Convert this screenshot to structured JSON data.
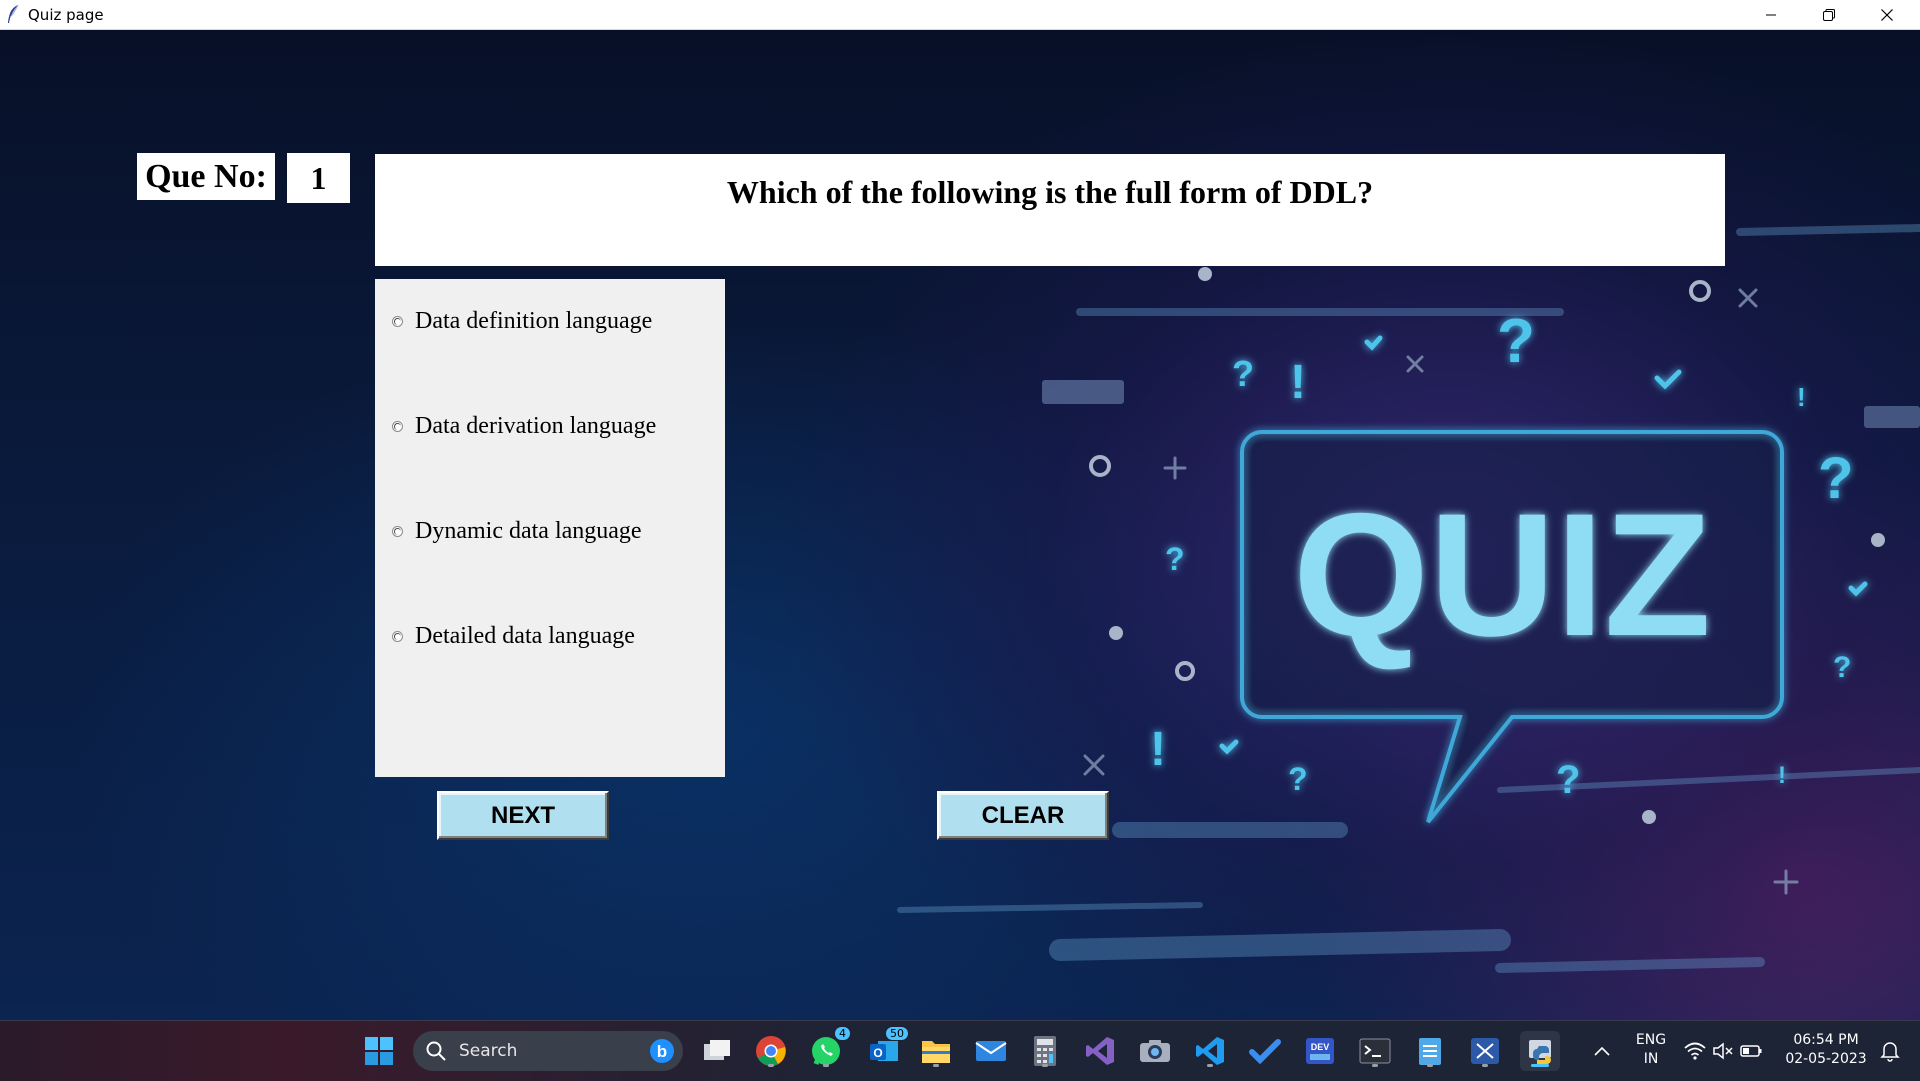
{
  "window": {
    "title": "Quiz page"
  },
  "quiz": {
    "que_no_label": "Que No:",
    "que_no_value": "1",
    "question": "Which of the following is the full form of DDL?",
    "options": [
      "Data definition language",
      "Data derivation language",
      "Dynamic data language",
      "Detailed data language"
    ],
    "next_label": "NEXT",
    "clear_label": "CLEAR",
    "banner_text": "QUIZ"
  },
  "taskbar": {
    "search_placeholder": "Search",
    "whatsapp_badge": "4",
    "outlook_badge": "50",
    "language_top": "ENG",
    "language_bottom": "IN",
    "time": "06:54 PM",
    "date": "02-05-2023"
  },
  "colors": {
    "button_bg": "#b0e0f0",
    "quiz_glow": "#8fdcf5",
    "accent": "#4cc2ff"
  }
}
